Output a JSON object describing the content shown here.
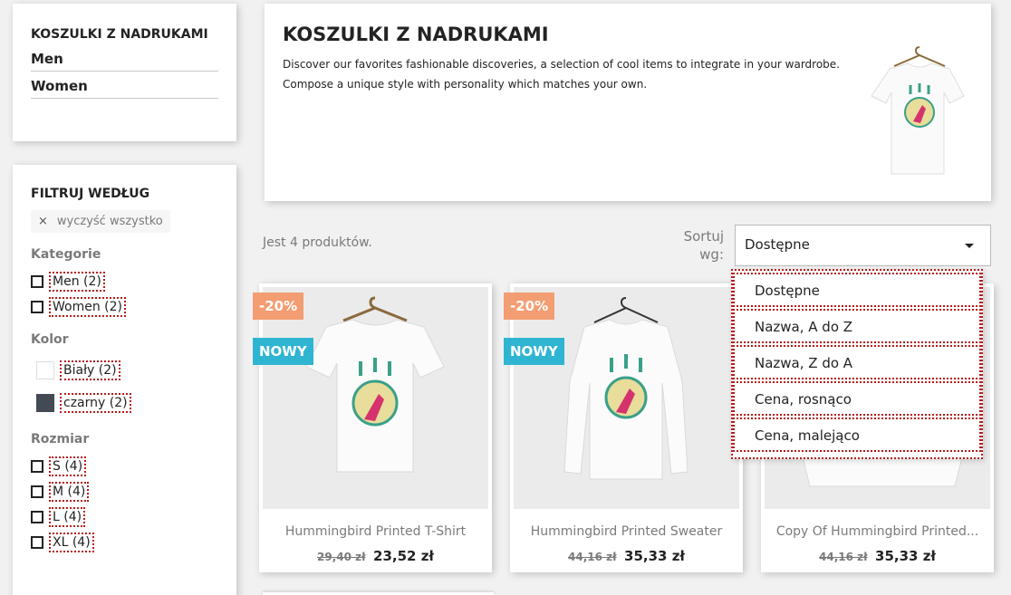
{
  "category_block": {
    "title": "KOSZULKI Z NADRUKAMI",
    "links": [
      "Men",
      "Women"
    ]
  },
  "facets": {
    "title": "FILTRUJ WEDŁUG",
    "clear_all": "wyczyść wszystko",
    "clear_icon": "×",
    "groups": {
      "category": {
        "title": "Kategorie",
        "items": [
          "Men (2)",
          "Women (2)"
        ]
      },
      "color": {
        "title": "Kolor",
        "items": [
          {
            "label": "Biały (2)",
            "color": "#ffffff"
          },
          {
            "label": "czarny (2)",
            "color": "#434a54"
          }
        ]
      },
      "size": {
        "title": "Rozmiar",
        "items": [
          "S (4)",
          "M (4)",
          "L (4)",
          "XL (4)"
        ]
      }
    }
  },
  "header": {
    "title": "KOSZULKI Z NADRUKAMI",
    "description": "Discover our favorites fashionable discoveries, a selection of cool items to integrate in your wardrobe. Compose a unique style with personality which matches your own."
  },
  "listing": {
    "count": "Jest 4 produktów.",
    "sort_label": "Sortuj wg:",
    "sort_selected": "Dostępne",
    "sort_options": [
      "Dostępne",
      "Nazwa, A do Z",
      "Nazwa, Z do A",
      "Cena, rosnąco",
      "Cena, malejąco"
    ]
  },
  "products": [
    {
      "name": "Hummingbird Printed T-Shirt",
      "old_price": "29,40 zł",
      "price": "23,52 zł",
      "discount": "-20%",
      "badge": "NOWY"
    },
    {
      "name": "Hummingbird Printed Sweater",
      "old_price": "44,16 zł",
      "price": "35,33 zł",
      "discount": "-20%",
      "badge": "NOWY"
    },
    {
      "name": "Copy Of Hummingbird Printed...",
      "old_price": "44,16 zł",
      "price": "35,33 zł"
    }
  ],
  "colors": {
    "accent_blue": "#2fb5d2",
    "discount_orange": "#f39d72",
    "focus_red": "#b71c1c"
  }
}
